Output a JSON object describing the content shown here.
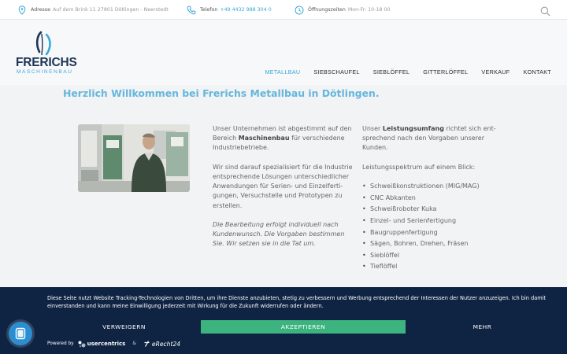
{
  "topbar": {
    "address": {
      "label": "Adresse",
      "value": "Auf dem Brink 11 27801 Dötlingen - Neerstedt",
      "icon": "location-pin-icon"
    },
    "phone": {
      "label": "Telefon",
      "value": "+49 4432 988 304 0",
      "icon": "phone-icon"
    },
    "hours": {
      "label": "Öffnungszeiten",
      "value": "Mon-Fr: 10-18 00",
      "icon": "clock-icon"
    },
    "search_icon": "search-icon"
  },
  "logo": {
    "name": "FRERICHS",
    "sub": "MASCHINENBAU"
  },
  "nav": {
    "items": [
      {
        "label": "METALLBAU",
        "active": true
      },
      {
        "label": "SIEBSCHAUFEL",
        "active": false
      },
      {
        "label": "SIEBLÖFFEL",
        "active": false
      },
      {
        "label": "GITTERLÖFFEL",
        "active": false
      },
      {
        "label": "VERKAUF",
        "active": false
      },
      {
        "label": "KONTAKT",
        "active": false
      }
    ]
  },
  "main": {
    "headline": "Herzlich Willkommen bei Frerichs Metallbau in Dötlingen.",
    "col1": {
      "p1_pre": "Unser Unternehmen ist abgestimmt auf den Bereich ",
      "p1_bold": "Maschinenbau",
      "p1_post": " für verschiedene Industriebetriebe.",
      "p2": "Wir sind darauf spezialisiert für die Industrie entsprechende Lösungen unterschiedlicher Anwendungen für Serien- und Einzelferti-gungen, Versuchstelle und Prototypen zu erstellen.",
      "p3": "Die Bearbeitung erfolgt individuell nach Kundenwunsch. Die Vorgaben bestimmen Sie. Wir setzen sie in die Tat um."
    },
    "col2": {
      "p1_pre": "Unser ",
      "p1_bold": "Leistungsumfang",
      "p1_post": " richtet sich ent-sprechend nach den Vorgaben unserer Kunden.",
      "list_title": "Leistungsspektrum auf einem Blick:",
      "items": [
        "Schweißkonstruktionen (MIG/MAG)",
        "CNC Abkanten",
        "Schweißroboter Kuka",
        "Einzel- und Serienfertigung",
        "Baugruppenfertigung",
        "Sägen, Bohren, Drehen, Fräsen",
        "Sieblöffel",
        "Tieflöffel"
      ]
    }
  },
  "cookie": {
    "text": "Diese Seite nutzt Website Tracking-Technologien von Dritten, um ihre Dienste anzubieten, stetig zu verbessern und Werbung entsprechend der Interessen der Nutzer anzuzeigen. Ich bin damit einverstanden und kann meine Einwilligung jederzeit mit Wirkung für die Zukunft widerrufen oder ändern.",
    "deny": "VERWEIGERN",
    "accept": "AKZEPTIEREN",
    "more": "MEHR",
    "powered_by": "Powered by",
    "usercentrics": "usercentrics",
    "amp": "&",
    "erecht": "eRecht24"
  },
  "colors": {
    "accent": "#3aa7d8",
    "banner": "#0f2343",
    "accept": "#3db480",
    "brand_dark": "#1d3554"
  }
}
